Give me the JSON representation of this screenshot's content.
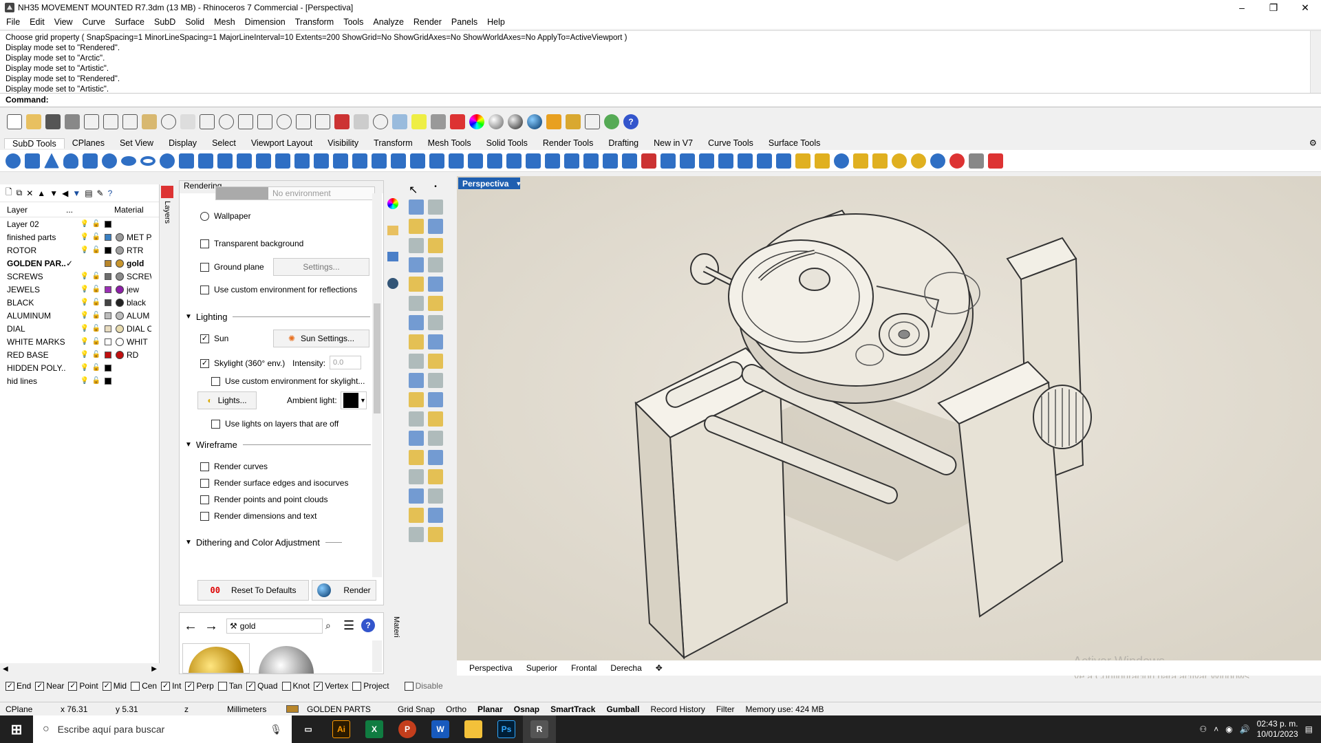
{
  "window": {
    "title": "NH35 MOVEMENT MOUNTED R7.3dm (13 MB) - Rhinoceros 7 Commercial - [Perspectiva]",
    "buttons": [
      "–",
      "❐",
      "✕"
    ]
  },
  "menu": [
    "File",
    "Edit",
    "View",
    "Curve",
    "Surface",
    "SubD",
    "Solid",
    "Mesh",
    "Dimension",
    "Transform",
    "Tools",
    "Analyze",
    "Render",
    "Panels",
    "Help"
  ],
  "command_history": [
    "Choose grid property ( SnapSpacing=1  MinorLineSpacing=1  MajorLineInterval=10  Extents=200  ShowGrid=No  ShowGridAxes=No  ShowWorldAxes=No  ApplyTo=ActiveViewport )",
    "Display mode set to \"Rendered\".",
    "Display mode set to \"Arctic\".",
    "Display mode set to \"Artistic\".",
    "Display mode set to \"Rendered\".",
    "Display mode set to \"Artistic\"."
  ],
  "command_prompt": "Command:",
  "toolbar_tabs": [
    "SubD Tools",
    "CPlanes",
    "Set View",
    "Display",
    "Select",
    "Viewport Layout",
    "Visibility",
    "Transform",
    "Mesh Tools",
    "Solid Tools",
    "Render Tools",
    "Drafting",
    "New in V7",
    "Curve Tools",
    "Surface Tools"
  ],
  "layers_panel": {
    "side_tab": "Layers",
    "col_layer": "Layer",
    "col_dots": "...",
    "col_material": "Material",
    "rows": [
      {
        "name": "Layer 02",
        "color": "#000000",
        "material": "",
        "mat_color": "",
        "current": false
      },
      {
        "name": "finished parts",
        "color": "#3a7fc1",
        "material": "MET PA",
        "mat_color": "#9a9a9a",
        "current": false
      },
      {
        "name": "ROTOR",
        "color": "#000000",
        "material": "RTR",
        "mat_color": "#a0a0a0",
        "current": false
      },
      {
        "name": "GOLDEN PAR...",
        "color": "#b8862b",
        "material": "gold",
        "mat_color": "#c8962e",
        "current": true
      },
      {
        "name": "SCREWS",
        "color": "#6d6d6d",
        "material": "SCREW",
        "mat_color": "#8c8c8c",
        "current": false
      },
      {
        "name": "JEWELS",
        "color": "#9b2fb5",
        "material": "jew",
        "mat_color": "#8e1fa8",
        "current": false
      },
      {
        "name": "BLACK",
        "color": "#444444",
        "material": "black",
        "mat_color": "#222222",
        "current": false
      },
      {
        "name": "ALUMINUM",
        "color": "#bdbdbd",
        "material": "ALUM",
        "mat_color": "#bdbdbd",
        "current": false
      },
      {
        "name": "DIAL",
        "color": "#e8dcc0",
        "material": "DIAL C",
        "mat_color": "#e8dcb0",
        "current": false
      },
      {
        "name": "WHITE MARKS",
        "color": "#ffffff",
        "material": "WHIT",
        "mat_color": "#ffffff",
        "current": false
      },
      {
        "name": "RED BASE",
        "color": "#c01010",
        "material": "RD",
        "mat_color": "#c01010",
        "current": false
      },
      {
        "name": "HIDDEN POLY...",
        "color": "#000000",
        "material": "",
        "mat_color": "",
        "current": false
      },
      {
        "name": "hid lines",
        "color": "#000000",
        "material": "",
        "mat_color": "",
        "current": false
      }
    ]
  },
  "rendering_panel": {
    "title": "Rendering",
    "environment_value": "No environment",
    "wallpaper": "Wallpaper",
    "transparent_bg": "Transparent background",
    "ground_plane": "Ground plane",
    "settings_btn": "Settings...",
    "custom_env_reflections": "Use custom environment for reflections",
    "lighting_header": "Lighting",
    "sun": "Sun",
    "sun_settings_btn": "Sun Settings...",
    "skylight": "Skylight (360° env.)",
    "intensity_label": "Intensity:",
    "intensity_value": "0.0",
    "custom_env_skylight": "Use custom environment for skylight...",
    "lights_btn": "Lights...",
    "ambient_label": "Ambient light:",
    "lights_on_layers_off": "Use lights on layers that are off",
    "wireframe_header": "Wireframe",
    "render_curves": "Render curves",
    "render_surface_edges": "Render surface edges and isocurves",
    "render_points": "Render points and point clouds",
    "render_dimensions": "Render dimensions and text",
    "dithering_header": "Dithering and Color Adjustment",
    "reset_btn": "Reset To Defaults",
    "render_btn": "Render"
  },
  "material_panel": {
    "search_value": "gold",
    "side_tab": "Materi"
  },
  "viewport": {
    "active_label": "Perspectiva",
    "tabs": [
      "Perspectiva",
      "Superior",
      "Frontal",
      "Derecha"
    ],
    "watermark_line1": "Activar Windows",
    "watermark_line2": "Ve a Configuración para activar Windows."
  },
  "osnaps": [
    {
      "label": "End",
      "checked": true
    },
    {
      "label": "Near",
      "checked": true
    },
    {
      "label": "Point",
      "checked": true
    },
    {
      "label": "Mid",
      "checked": true
    },
    {
      "label": "Cen",
      "checked": false
    },
    {
      "label": "Int",
      "checked": true
    },
    {
      "label": "Perp",
      "checked": true
    },
    {
      "label": "Tan",
      "checked": false
    },
    {
      "label": "Quad",
      "checked": true
    },
    {
      "label": "Knot",
      "checked": false
    },
    {
      "label": "Vertex",
      "checked": true
    },
    {
      "label": "Project",
      "checked": false
    },
    {
      "label": "Disable",
      "checked": false
    }
  ],
  "status": {
    "cplane": "CPlane",
    "x": "x 76.31",
    "y": "y 5.31",
    "z": "z",
    "units": "Millimeters",
    "layer": "GOLDEN PARTS",
    "toggles": [
      "Grid Snap",
      "Ortho",
      "Planar",
      "Osnap",
      "SmartTrack",
      "Gumball",
      "Record History",
      "Filter"
    ],
    "memory": "Memory use: 424 MB"
  },
  "taskbar": {
    "search_placeholder": "Escribe aquí para buscar",
    "time": "02:43 p. m.",
    "date": "10/01/2023"
  }
}
